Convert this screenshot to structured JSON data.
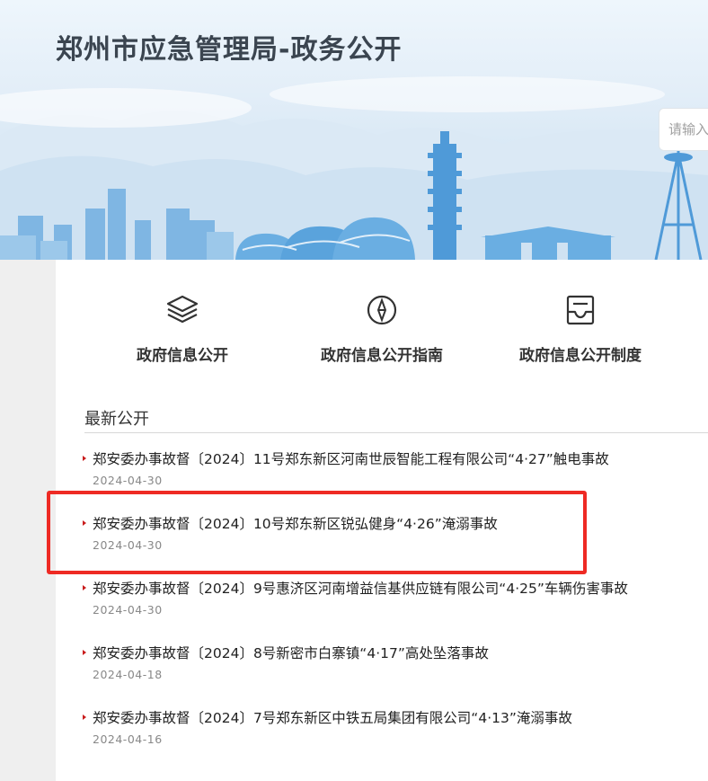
{
  "header": {
    "site_title": "郑州市应急管理局-政务公开",
    "search_placeholder": "请输入"
  },
  "quick_links": [
    {
      "label": "政府信息公开",
      "icon": "layers-icon"
    },
    {
      "label": "政府信息公开指南",
      "icon": "compass-icon"
    },
    {
      "label": "政府信息公开制度",
      "icon": "document-tray-icon"
    }
  ],
  "latest": {
    "title": "最新公开",
    "items": [
      {
        "title": "郑安委办事故督〔2024〕11号郑东新区河南世辰智能工程有限公司“4·27”触电事故",
        "date": "2024-04-30"
      },
      {
        "title": "郑安委办事故督〔2024〕10号郑东新区锐弘健身“4·26”淹溺事故",
        "date": "2024-04-30"
      },
      {
        "title": "郑安委办事故督〔2024〕9号惠济区河南增益信基供应链有限公司“4·25”车辆伤害事故",
        "date": "2024-04-30"
      },
      {
        "title": "郑安委办事故督〔2024〕8号新密市白寨镇“4·17”高处坠落事故",
        "date": "2024-04-18"
      },
      {
        "title": "郑安委办事故督〔2024〕7号郑东新区中铁五局集团有限公司“4·13”淹溺事故",
        "date": "2024-04-16"
      }
    ]
  },
  "colors": {
    "accent_red": "#c91c1c",
    "highlight_red": "#ee2a24",
    "skyline_blue": "#5aa3dc"
  }
}
